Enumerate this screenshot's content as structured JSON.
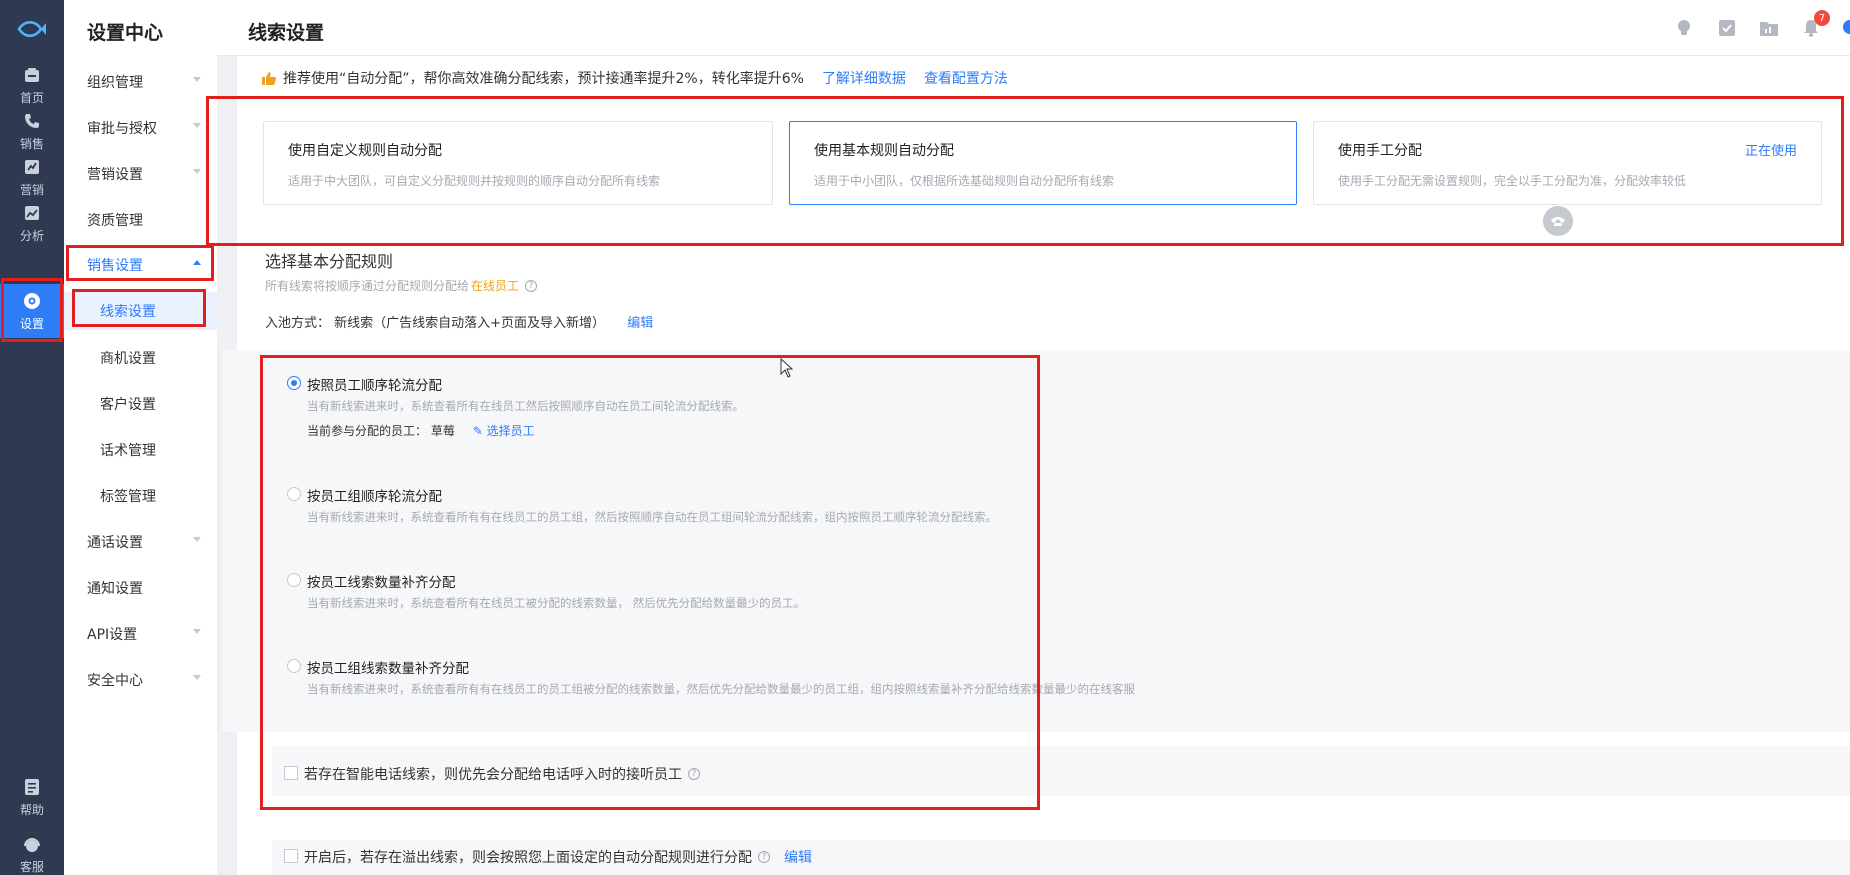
{
  "rail": {
    "items": [
      {
        "label": "首页",
        "icon": "home-icon"
      },
      {
        "label": "销售",
        "icon": "phone-icon"
      },
      {
        "label": "营销",
        "icon": "marketing-icon"
      },
      {
        "label": "分析",
        "icon": "chart-icon"
      },
      {
        "label": "设置",
        "icon": "settings-icon",
        "active": true
      },
      {
        "label": "帮助",
        "icon": "help-icon"
      },
      {
        "label": "客服",
        "icon": "service-icon"
      }
    ]
  },
  "sidebar": {
    "title": "设置中心",
    "items": [
      {
        "label": "组织管理"
      },
      {
        "label": "审批与授权"
      },
      {
        "label": "营销设置"
      },
      {
        "label": "资质管理"
      },
      {
        "label": "销售设置",
        "open": true
      },
      {
        "label": "线索设置",
        "selected": true
      },
      {
        "label": "商机设置"
      },
      {
        "label": "客户设置"
      },
      {
        "label": "话术管理"
      },
      {
        "label": "标签管理"
      },
      {
        "label": "通话设置"
      },
      {
        "label": "通知设置"
      },
      {
        "label": "API设置"
      },
      {
        "label": "安全中心"
      }
    ]
  },
  "header": {
    "title": "线索设置",
    "notification_count": "7",
    "icons": [
      "lightbulb-icon",
      "task-icon",
      "folder-icon",
      "bell-icon"
    ]
  },
  "tip": {
    "text": "推荐使用“自动分配”，帮你高效准确分配线索，预计接通率提升2%，转化率提升6%",
    "link1": "了解详细数据",
    "link2": "查看配置方法"
  },
  "modes": [
    {
      "title": "使用自定义规则自动分配",
      "desc": "适用于中大团队，可自定义分配规则并按规则的顺序自动分配所有线索"
    },
    {
      "title": "使用基本规则自动分配",
      "desc": "适用于中小团队，仅根据所选基础规则自动分配所有线索",
      "selected": true
    },
    {
      "title": "使用手工分配",
      "desc": "使用手工分配无需设置规则，完全以手工分配为准，分配效率较低",
      "status": "正在使用"
    }
  ],
  "basic_rules": {
    "title": "选择基本分配规则",
    "desc_prefix": "所有线索将按顺序通过分配规则分配给",
    "desc_highlight": "在线员工",
    "pool_label": "入池方式：",
    "pool_value": "新线索（广告线索自动落入+页面及导入新增）",
    "pool_edit": "编辑"
  },
  "rules": [
    {
      "title": "按照员工顺序轮流分配",
      "desc": "当有新线索进来时，系统查看所有在线员工然后按照顺序自动在员工间轮流分配线索。",
      "checked": true,
      "staff_label": "当前参与分配的员工：",
      "staff_value": "草莓",
      "staff_link": "选择员工"
    },
    {
      "title": "按员工组顺序轮流分配",
      "desc": "当有新线索进来时，系统查看所有有在线员工的员工组，然后按照顺序自动在员工组间轮流分配线索，组内按照员工顺序轮流分配线索。",
      "checked": false
    },
    {
      "title": "按员工线索数量补齐分配",
      "desc": "当有新线索进来时，系统查看所有在线员工被分配的线索数量， 然后优先分配给数量最少的员工。",
      "checked": false
    },
    {
      "title": "按员工组线索数量补齐分配",
      "desc": "当有新线索进来时，系统查看所有有在线员工的员工组被分配的线索数量，然后优先分配给数量最少的员工组，组内按照线索量补齐分配给线索数量最少的在线客服",
      "checked": false
    }
  ],
  "smart_phone_option": {
    "label": "若存在智能电话线索，则优先会分配给电话呼入时的接听员工"
  },
  "overflow_option": {
    "label": "开启后，若存在溢出线索，则会按照您上面设定的自动分配规则进行分配",
    "edit": "编辑"
  },
  "colors": {
    "accent": "#2e7cf6",
    "rail_bg": "#2f3a52",
    "highlight_box": "#e0201c",
    "warning_text": "#e8a317"
  }
}
